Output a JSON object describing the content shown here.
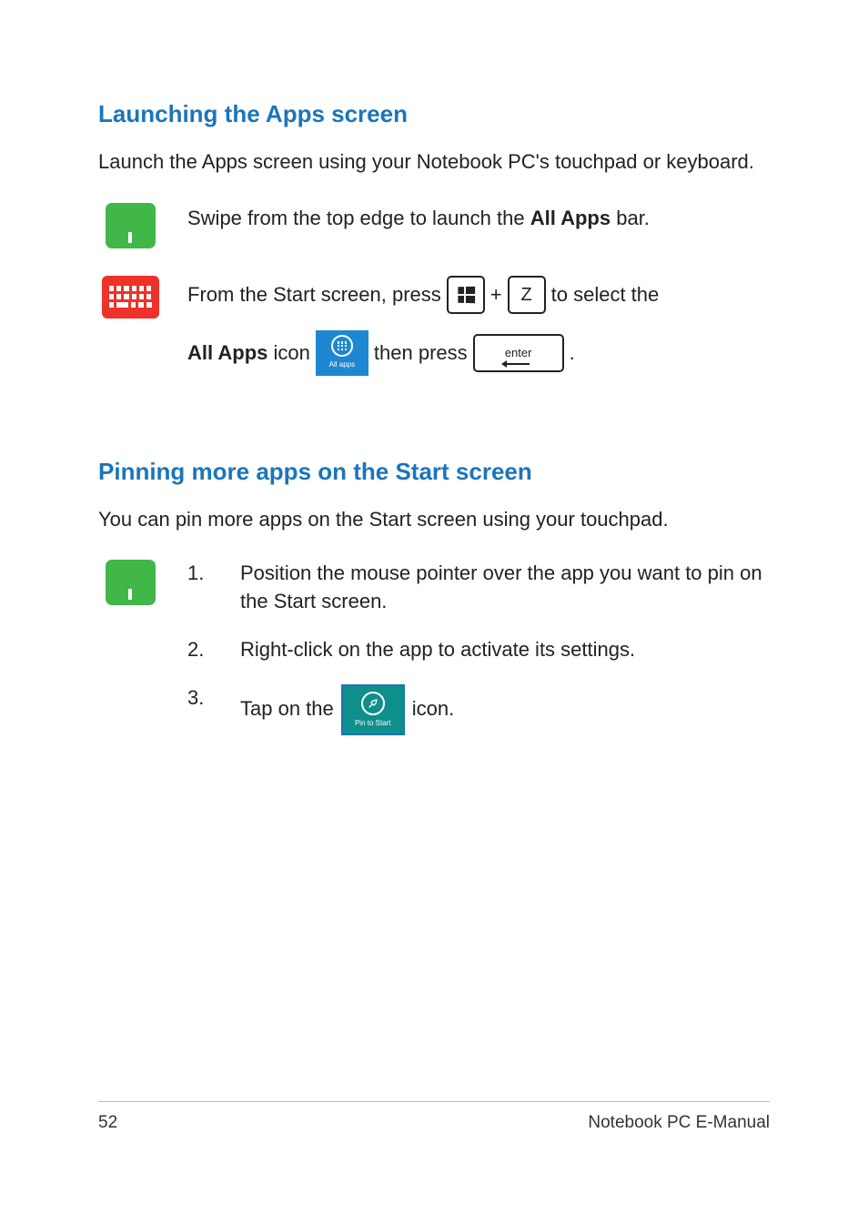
{
  "section1": {
    "heading": "Launching the Apps screen",
    "intro": "Launch the Apps screen using your Notebook PC's touchpad or keyboard.",
    "touchpad_text_pre": "Swipe from the top edge to launch the ",
    "touchpad_text_bold": "All Apps",
    "touchpad_text_post": " bar.",
    "kb_line1_pre": "From the Start screen, press",
    "kb_plus": "+",
    "kb_z": "Z",
    "kb_line1_post": "to select the",
    "kb_line2_bold": "All Apps",
    "kb_line2_mid": " icon",
    "kb_line2_then": "then press",
    "kb_line2_period": ".",
    "allapps_label": "All apps",
    "enter_label": "enter"
  },
  "section2": {
    "heading": "Pinning more apps on the Start screen",
    "intro": "You can pin more apps on the Start screen using your touchpad.",
    "steps": [
      {
        "num": "1.",
        "text": "Position the mouse pointer over the app you want to pin on the Start screen."
      },
      {
        "num": "2.",
        "text": "Right-click on the app to activate its settings."
      },
      {
        "num": "3.",
        "pre": "Tap on the",
        "post": "icon."
      }
    ],
    "pin_label": "Pin to Start"
  },
  "footer": {
    "page": "52",
    "title": "Notebook PC E-Manual"
  }
}
